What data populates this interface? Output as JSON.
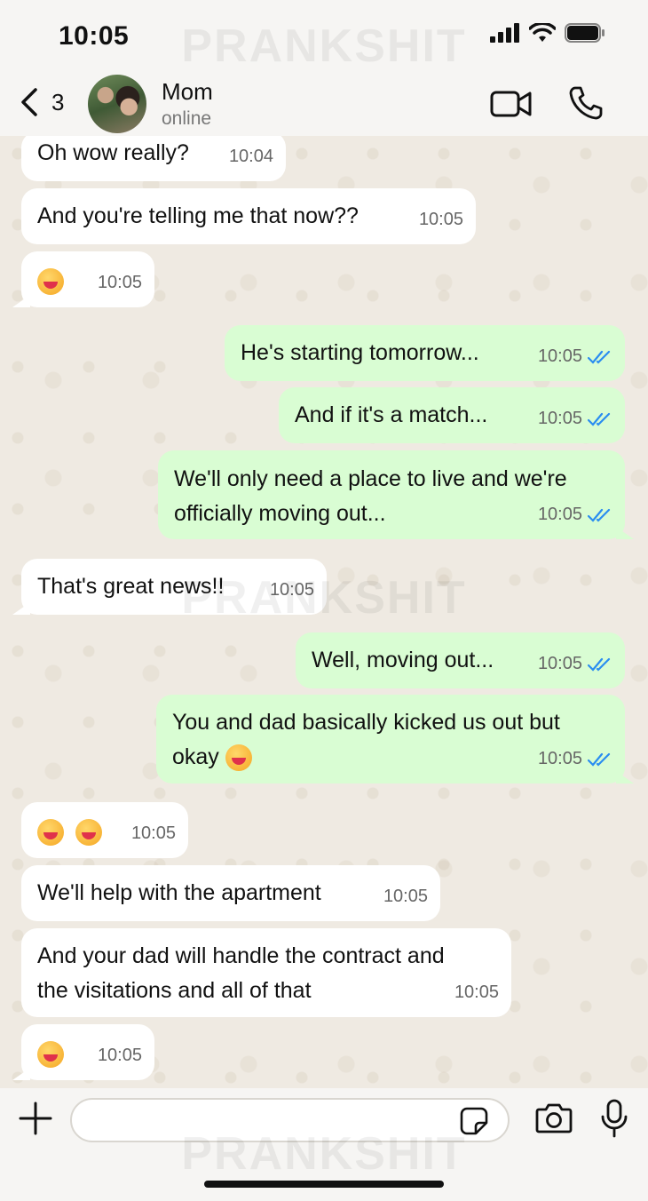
{
  "status": {
    "time": "10:05"
  },
  "watermark": "PRANKSHIT",
  "header": {
    "back_count": "3",
    "contact_name": "Mom",
    "contact_status": "online"
  },
  "messages": [
    {
      "dir": "in",
      "text": "Oh wow really?",
      "time": "10:04"
    },
    {
      "dir": "in",
      "text": "And you're telling me that now??",
      "time": "10:05"
    },
    {
      "dir": "in",
      "emoji": "grinning-face",
      "time": "10:05"
    },
    {
      "dir": "out",
      "text": "He's starting tomorrow...",
      "time": "10:05",
      "read": true
    },
    {
      "dir": "out",
      "text": "And if it's a match...",
      "time": "10:05",
      "read": true
    },
    {
      "dir": "out",
      "text": "We'll only need a place to live and we're",
      "text2": "officially moving out...",
      "time": "10:05",
      "read": true
    },
    {
      "dir": "in",
      "text": "That's great news!!",
      "time": "10:05"
    },
    {
      "dir": "out",
      "text": "Well, moving out...",
      "time": "10:05",
      "read": true
    },
    {
      "dir": "out",
      "text": "You and dad basically kicked us out but",
      "text2": "okay",
      "emoji": "tears-of-joy",
      "time": "10:05",
      "read": true
    },
    {
      "dir": "in",
      "emoji": "grinning-sweat x2",
      "time": "10:05"
    },
    {
      "dir": "in",
      "text": "We'll help with the apartment",
      "time": "10:05"
    },
    {
      "dir": "in",
      "text": "And your dad will handle the contract and",
      "text2": "the visitations and all of that",
      "time": "10:05"
    },
    {
      "dir": "in",
      "emoji": "face-blowing-kiss",
      "time": "10:05"
    }
  ],
  "composer": {
    "placeholder": ""
  },
  "colors": {
    "incoming": "#ffffff",
    "outgoing": "#d9fdd3",
    "read_ticks": "#2a8df0"
  }
}
